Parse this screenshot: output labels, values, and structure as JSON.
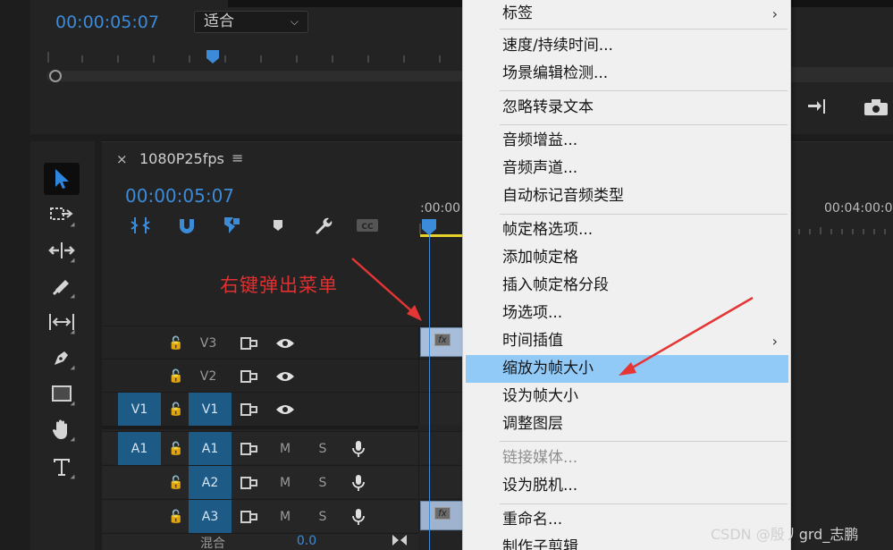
{
  "program_monitor": {
    "timecode": "00:00:05:07",
    "fit_select": "适合"
  },
  "timeline": {
    "tab_close": "×",
    "sequence_name": "1080P25fps",
    "tab_menu": "≡",
    "timecode": "00:00:05:07",
    "ruler_start": ":00:00",
    "ruler_end": "00:04:00:00",
    "tracks": {
      "v3": {
        "lock": "🔓",
        "label": "V3"
      },
      "v2": {
        "lock": "🔓",
        "label": "V2"
      },
      "v1": {
        "source": "V1",
        "lock": "🔓",
        "label": "V1"
      },
      "a1": {
        "source": "A1",
        "lock": "🔓",
        "label": "A1",
        "mute": "M",
        "solo": "S"
      },
      "a2": {
        "lock": "🔓",
        "label": "A2",
        "mute": "M",
        "solo": "S"
      },
      "a3": {
        "lock": "🔓",
        "label": "A3",
        "mute": "M",
        "solo": "S"
      },
      "mix": {
        "label": "混合",
        "value": "0.0"
      }
    },
    "clip_fx": "fx"
  },
  "annotation": {
    "text": "右键弹出菜单",
    "color": "#e03131"
  },
  "context_menu": {
    "items": [
      {
        "label": "标签",
        "submenu": "›"
      },
      {
        "label": "速度/持续时间..."
      },
      {
        "label": "场景编辑检测..."
      },
      {
        "label": "忽略转录文本"
      },
      {
        "label": "音频增益..."
      },
      {
        "label": "音频声道..."
      },
      {
        "label": "自动标记音频类型"
      },
      {
        "label": "帧定格选项..."
      },
      {
        "label": "添加帧定格"
      },
      {
        "label": "插入帧定格分段"
      },
      {
        "label": "场选项..."
      },
      {
        "label": "时间插值",
        "submenu": "›"
      },
      {
        "label": "缩放为帧大小",
        "highlighted": true
      },
      {
        "label": "设为帧大小"
      },
      {
        "label": "调整图层"
      },
      {
        "label": "链接媒体...",
        "disabled": true
      },
      {
        "label": "设为脱机..."
      },
      {
        "label": "重命名..."
      },
      {
        "label": "制作子剪辑"
      }
    ],
    "highlight_color": "#91c9f7"
  },
  "watermark": "CSDN @殷丿grd_志鹏",
  "colors": {
    "accent": "#3b8bd9",
    "track_target": "#1e5a86"
  }
}
